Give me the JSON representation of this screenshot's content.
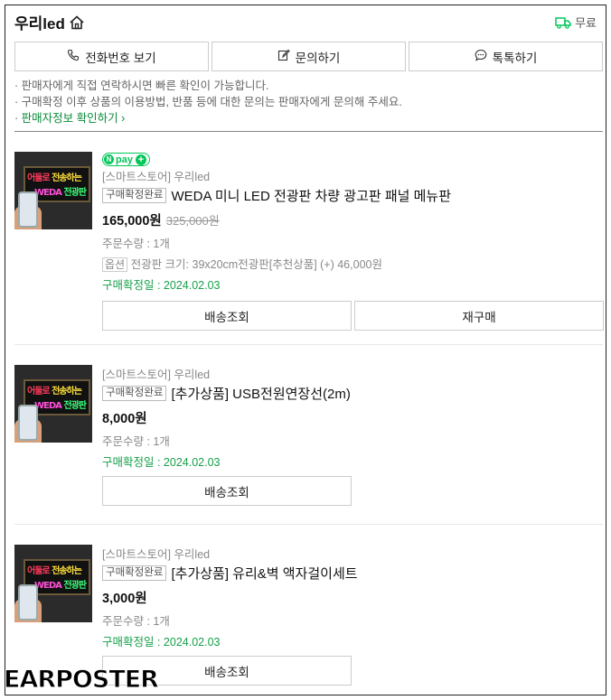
{
  "header": {
    "store_name": "우리led",
    "delivery_label": "무료"
  },
  "buttons": {
    "phone": "전화번호 보기",
    "inquiry": "문의하기",
    "talk": "톡톡하기"
  },
  "notices": {
    "line1": "· 판매자에게 직접 연락하시면 빠른 확인이 가능합니다.",
    "line2": "· 구매확정 이후 상품의 이용방법, 반품 등에 대한 문의는 판매자에게 문의해 주세요.",
    "bullet3": "· ",
    "link": "판매자정보 확인하기",
    "link_arrow": "›"
  },
  "npay": {
    "n": "N",
    "label": "pay",
    "plus": "+"
  },
  "items": [
    {
      "store": "[스마트스토어] 우리led",
      "badge": "구매확정완료",
      "title": "WEDA 미니 LED 전광판 차량 광고판 패널 메뉴판",
      "price": "165,000원",
      "original_price": "325,000원",
      "quantity": "주문수량 : 1개",
      "option_label": "옵션",
      "option_text": "전광판 크기: 39x20cm전광판[추천상품] (+) 46,000원",
      "date": "구매확정일 : 2024.02.03",
      "btn_track": "배송조회",
      "btn_rebuy": "재구매"
    },
    {
      "store": "[스마트스토어] 우리led",
      "badge": "구매확정완료",
      "title": "[추가상품] USB전원연장선(2m)",
      "price": "8,000원",
      "quantity": "주문수량 : 1개",
      "date": "구매확정일 : 2024.02.03",
      "btn_track": "배송조회"
    },
    {
      "store": "[스마트스토어] 우리led",
      "badge": "구매확정완료",
      "title": "[추가상품] 유리&벽 액자걸이세트",
      "price": "3,000원",
      "quantity": "주문수량 : 1개",
      "date": "구매확정일 : 2024.02.03",
      "btn_track": "배송조회"
    }
  ],
  "thumb_text": {
    "line1a": "어둘로",
    "line1b": "전송하는",
    "line2a": "WEDA",
    "line2b": "전광판"
  },
  "watermark": "EARPOSTER",
  "colors": {
    "accent_green": "#03c75a",
    "date_green": "#16a04a",
    "link_green": "#0a8a3a"
  },
  "icons": {
    "home": "home-icon",
    "truck": "truck-icon",
    "phone": "phone-icon",
    "edit": "edit-icon",
    "chat": "chat-icon"
  }
}
